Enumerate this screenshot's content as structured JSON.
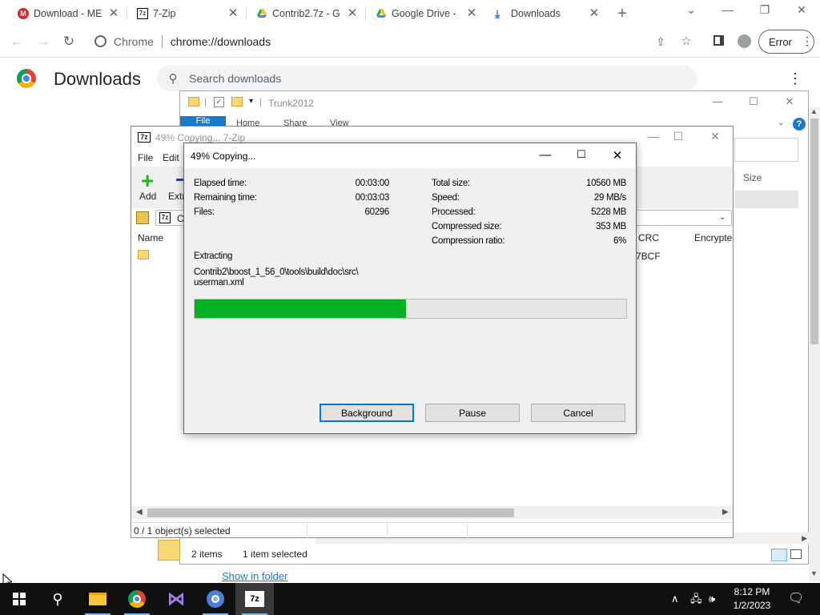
{
  "chrome": {
    "tabs": [
      {
        "title": "Download - ME",
        "icon": "mega-icon"
      },
      {
        "title": "7-Zip",
        "icon": "7zip-icon"
      },
      {
        "title": "Contrib2.7z - G",
        "icon": "google-drive-icon"
      },
      {
        "title": "Google Drive - ",
        "icon": "google-drive-icon"
      },
      {
        "title": "Downloads",
        "icon": "download-icon"
      }
    ],
    "site_label": "Chrome",
    "url": "chrome://downloads",
    "profile_label": "Error"
  },
  "downloads_page": {
    "title": "Downloads",
    "search_placeholder": "Search downloads",
    "show_in_folder": "Show in folder"
  },
  "explorer": {
    "title": "Trunk2012",
    "ribbon": [
      "File",
      "Home",
      "Share",
      "View"
    ],
    "size_header": "Size",
    "status_items": "2 items",
    "status_selected": "1 item selected"
  },
  "zip": {
    "title": "49% Copying... 7-Zip",
    "logo": "7z",
    "menu": [
      "File",
      "Edit"
    ],
    "add_label": "Add",
    "extract_label": "Extr",
    "path_fragment": "C",
    "columns": {
      "name": "Name",
      "crc": "CRC",
      "encrypted": "Encrypte"
    },
    "row_crc": "7BCF",
    "status": "0 / 1 object(s) selected"
  },
  "dialog": {
    "title": "49% Copying...",
    "elapsed_label": "Elapsed time:",
    "elapsed_value": "00:03:00",
    "remaining_label": "Remaining time:",
    "remaining_value": "00:03:03",
    "files_label": "Files:",
    "files_value": "60296",
    "total_size_label": "Total size:",
    "total_size_value": "10560 MB",
    "speed_label": "Speed:",
    "speed_value": "29 MB/s",
    "processed_label": "Processed:",
    "processed_value": "5228 MB",
    "compressed_label": "Compressed size:",
    "compressed_value": "353 MB",
    "ratio_label": "Compression ratio:",
    "ratio_value": "6%",
    "operation": "Extracting",
    "current_path": "Contrib2\\boost_1_56_0\\tools\\build\\doc\\src\\",
    "current_file": "userman.xml",
    "progress_fraction": 0.49,
    "progress_color": "#06b025",
    "buttons": {
      "background": "Background",
      "pause": "Pause",
      "cancel": "Cancel"
    }
  },
  "taskbar": {
    "time": "8:12 PM",
    "date": "1/2/2023"
  }
}
